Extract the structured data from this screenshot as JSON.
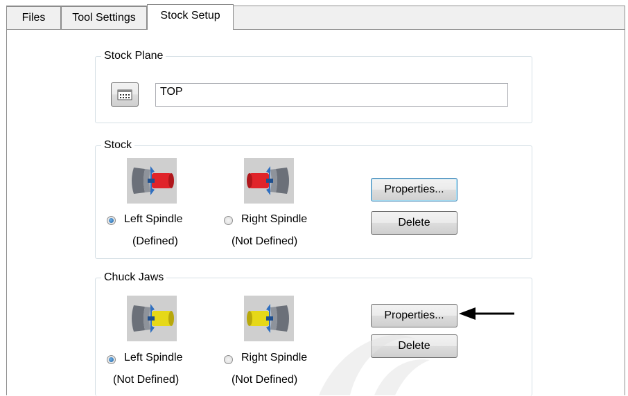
{
  "tabs": [
    {
      "label": "Files"
    },
    {
      "label": "Tool Settings"
    },
    {
      "label": "Stock Setup"
    }
  ],
  "stock_plane": {
    "title": "Stock Plane",
    "value": "TOP"
  },
  "stock": {
    "title": "Stock",
    "left_spindle": "Left Spindle",
    "left_status": "(Defined)",
    "right_spindle": "Right Spindle",
    "right_status": "(Not Defined)",
    "properties_label": "Properties...",
    "delete_label": "Delete",
    "selected": "left"
  },
  "chuck_jaws": {
    "title": "Chuck Jaws",
    "left_spindle": "Left Spindle",
    "left_status": "(Not Defined)",
    "right_spindle": "Right Spindle",
    "right_status": "(Not Defined)",
    "properties_label": "Properties...",
    "delete_label": "Delete",
    "selected": "left"
  },
  "colors": {
    "stock_part": "#e0242a",
    "jaws_part": "#e6d818",
    "chuck_body": "#7a7f88",
    "chuck_blue": "#2f6fc0"
  }
}
